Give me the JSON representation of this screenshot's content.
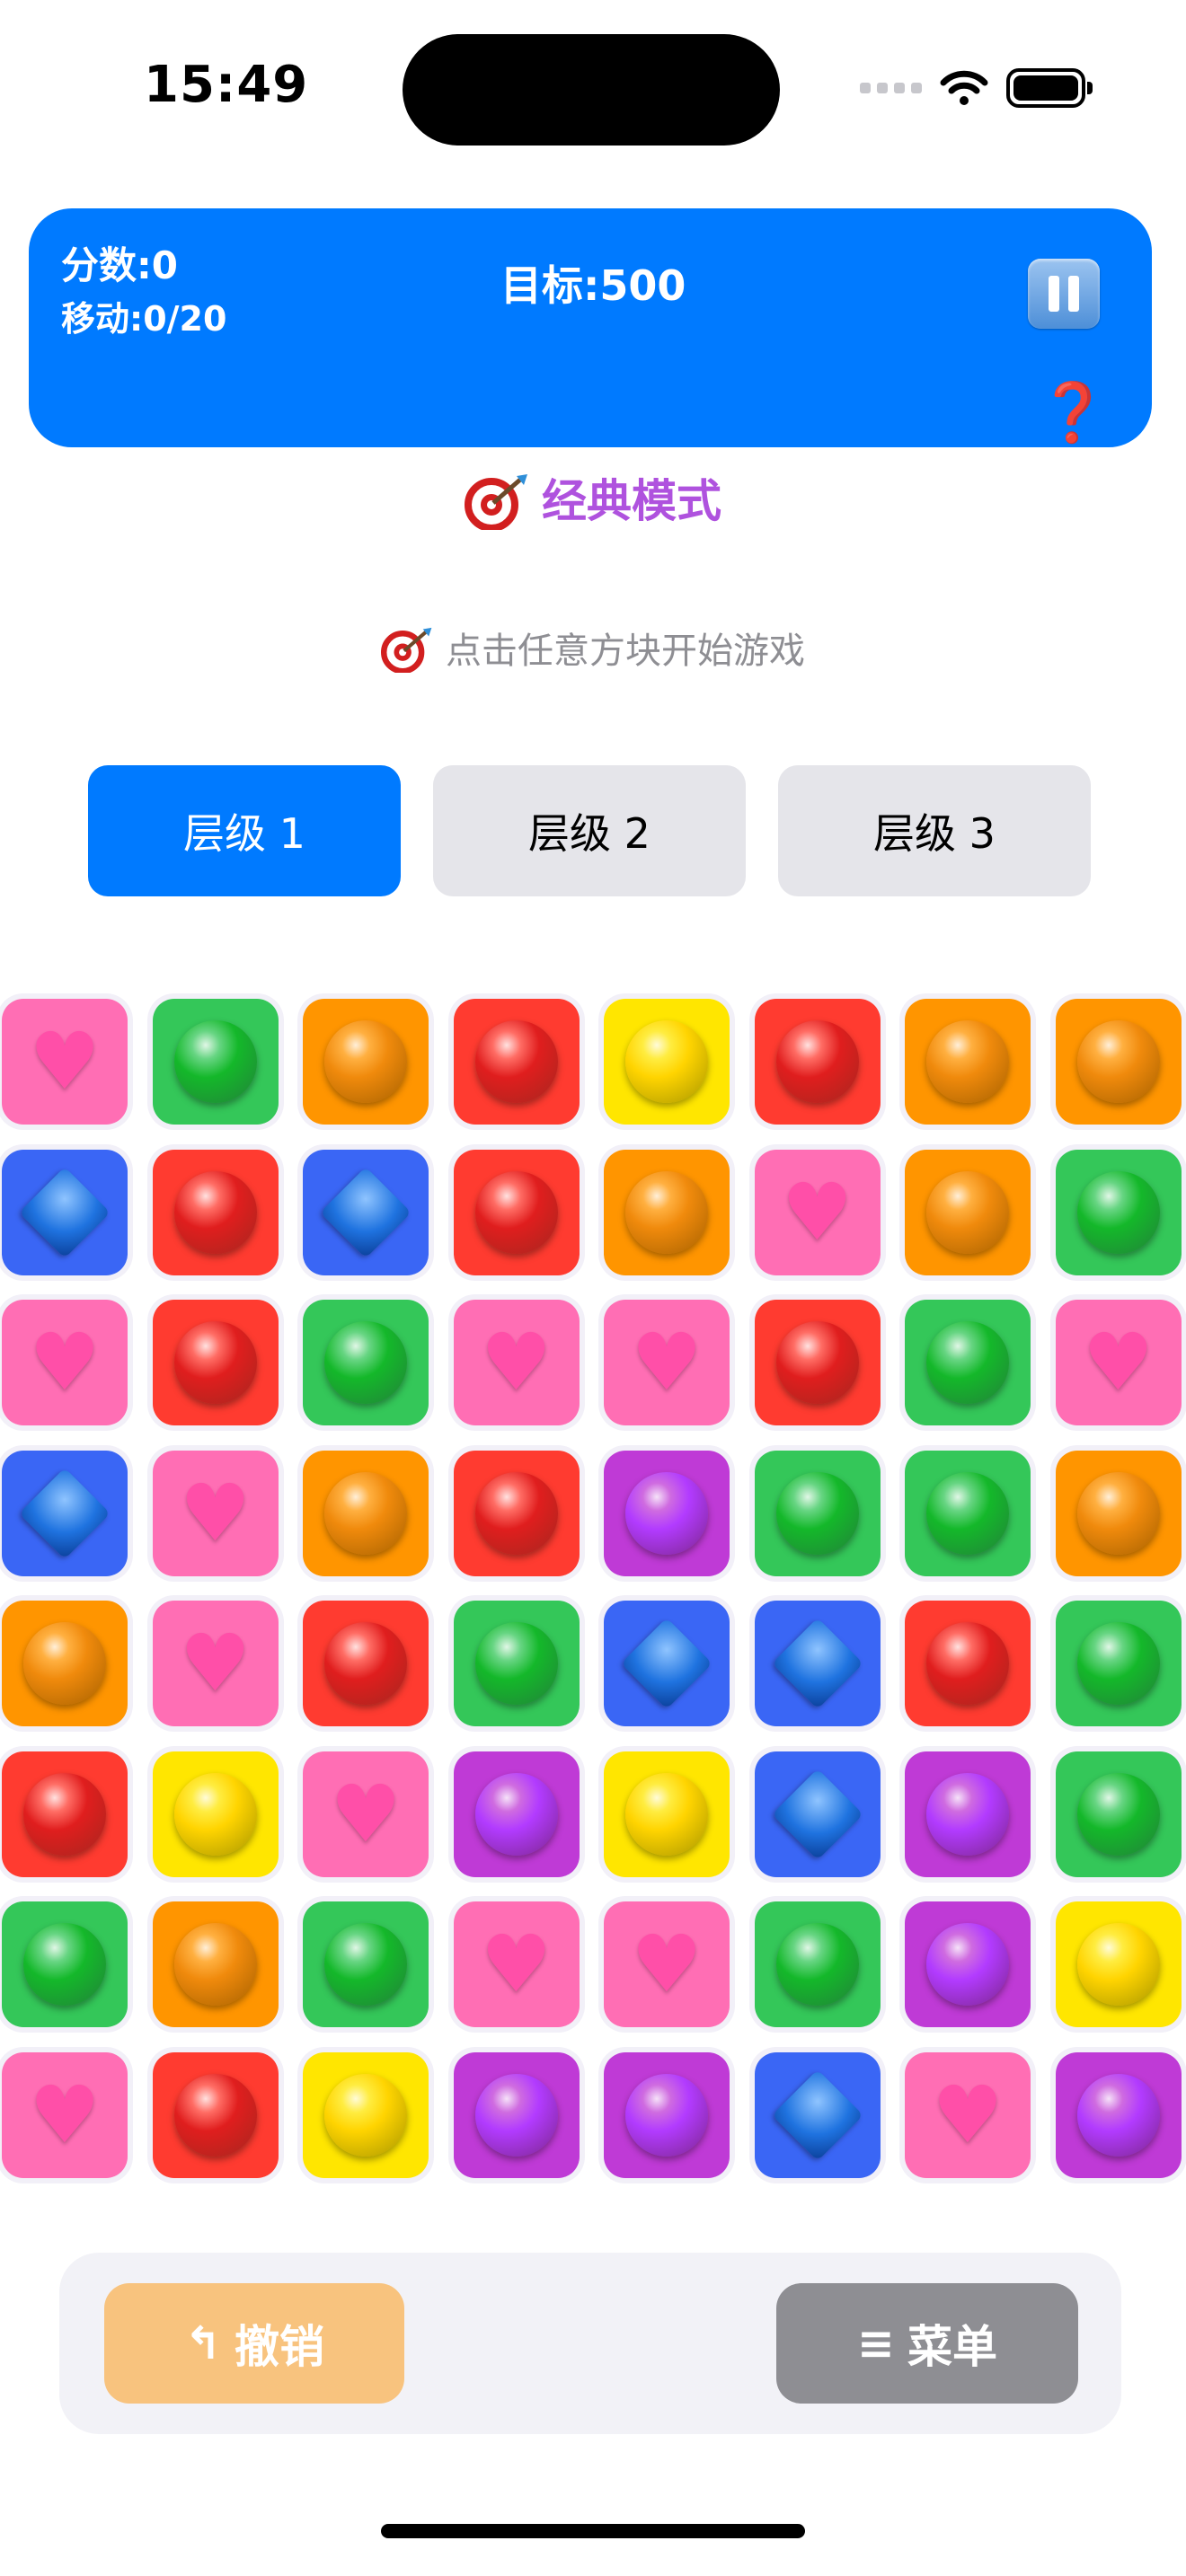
{
  "status_bar": {
    "time": "15:49"
  },
  "header": {
    "score": "分数:0",
    "moves": "移动:0/20",
    "target": "目标:500",
    "help_symbol": "❓"
  },
  "mode_title": "经典模式",
  "hint": "点击任意方块开始游戏",
  "levels": [
    "层级 1",
    "层级 2",
    "层级 3"
  ],
  "selected_level": "层级 1",
  "board": {
    "columns": 8,
    "rows": [
      [
        "heart",
        "green",
        "orange",
        "red",
        "yellow",
        "red",
        "orange",
        "orange"
      ],
      [
        "diamond",
        "red",
        "diamond",
        "red",
        "orange",
        "heart",
        "orange",
        "green"
      ],
      [
        "heart",
        "red",
        "green",
        "heart",
        "heart",
        "red",
        "green",
        "heart"
      ],
      [
        "diamond",
        "heart",
        "orange",
        "red",
        "purple",
        "green",
        "green",
        "orange"
      ],
      [
        "orange",
        "heart",
        "red",
        "green",
        "diamond",
        "diamond",
        "red",
        "green"
      ],
      [
        "red",
        "yellow",
        "heart",
        "purple",
        "yellow",
        "diamond",
        "purple",
        "green"
      ],
      [
        "green",
        "orange",
        "green",
        "heart",
        "heart",
        "green",
        "purple",
        "yellow"
      ],
      [
        "heart",
        "red",
        "yellow",
        "purple",
        "purple",
        "diamond",
        "heart",
        "purple"
      ]
    ]
  },
  "gem_styles": {
    "red": {
      "tile": "#ff3b30",
      "gem": "#e01e1e",
      "icon": "red-orb-icon"
    },
    "green": {
      "tile": "#34c759",
      "gem": "#14b82a",
      "icon": "green-orb-icon"
    },
    "orange": {
      "tile": "#ff9500",
      "gem": "#f08a0c",
      "icon": "orange-orb-icon"
    },
    "yellow": {
      "tile": "#ffe600",
      "gem": "#ffd400",
      "icon": "yellow-orb-icon"
    },
    "purple": {
      "tile": "#bf3ad6",
      "gem": "#b23bff",
      "icon": "purple-orb-icon"
    },
    "heart": {
      "tile": "#ff6eb4",
      "gem": "#ff4fa8",
      "icon": "pink-heart-icon"
    },
    "diamond": {
      "tile": "#3a66f5",
      "gem": "#1f73e0",
      "icon": "blue-diamond-icon"
    }
  },
  "controls": {
    "undo_icon": "↰",
    "undo_label": "撤销",
    "menu_icon": "≡",
    "menu_label": "菜单"
  }
}
